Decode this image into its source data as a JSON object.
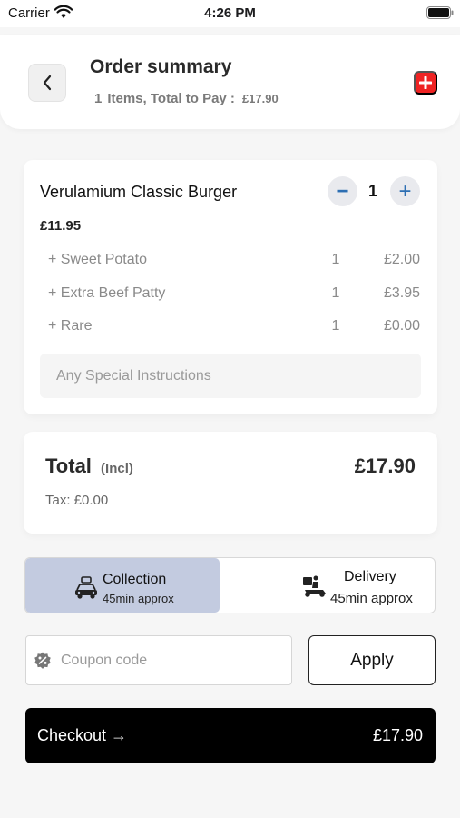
{
  "status_bar": {
    "carrier": "Carrier",
    "time": "4:26 PM"
  },
  "header": {
    "title": "Order summary",
    "items_count": "1",
    "items_text": "Items, Total to Pay :",
    "total": "£17.90"
  },
  "item": {
    "name": "Verulamium Classic Burger",
    "quantity": "1",
    "minus_symbol": "−",
    "plus_symbol": "+",
    "price": "£11.95",
    "extras": [
      {
        "name": "+ Sweet Potato",
        "qty": "1",
        "price": "£2.00"
      },
      {
        "name": "+ Extra Beef Patty",
        "qty": "1",
        "price": "£3.95"
      },
      {
        "name": "+ Rare",
        "qty": "1",
        "price": "£0.00"
      }
    ],
    "special_placeholder": "Any Special Instructions"
  },
  "totals": {
    "label": "Total",
    "incl": "(Incl)",
    "amount": "£17.90",
    "tax": "Tax: £0.00"
  },
  "order_mode": {
    "selected": "collection",
    "collection": {
      "label": "Collection",
      "time": "45min approx"
    },
    "delivery": {
      "label": "Delivery",
      "time": "45min approx"
    }
  },
  "coupon": {
    "placeholder": "Coupon code",
    "apply_label": "Apply"
  },
  "checkout": {
    "label": "Checkout →",
    "amount": "£17.90"
  },
  "colors": {
    "accent_red": "#ef2323",
    "stepper_blue": "#2d6fb3",
    "selected_option": "#c3cbe0",
    "checkout_bg": "#000000"
  },
  "icons": {
    "back": "chevron-left-icon",
    "add": "plus-icon",
    "collection": "car-icon",
    "delivery": "scooter-icon",
    "coupon": "badge-percent-icon"
  }
}
